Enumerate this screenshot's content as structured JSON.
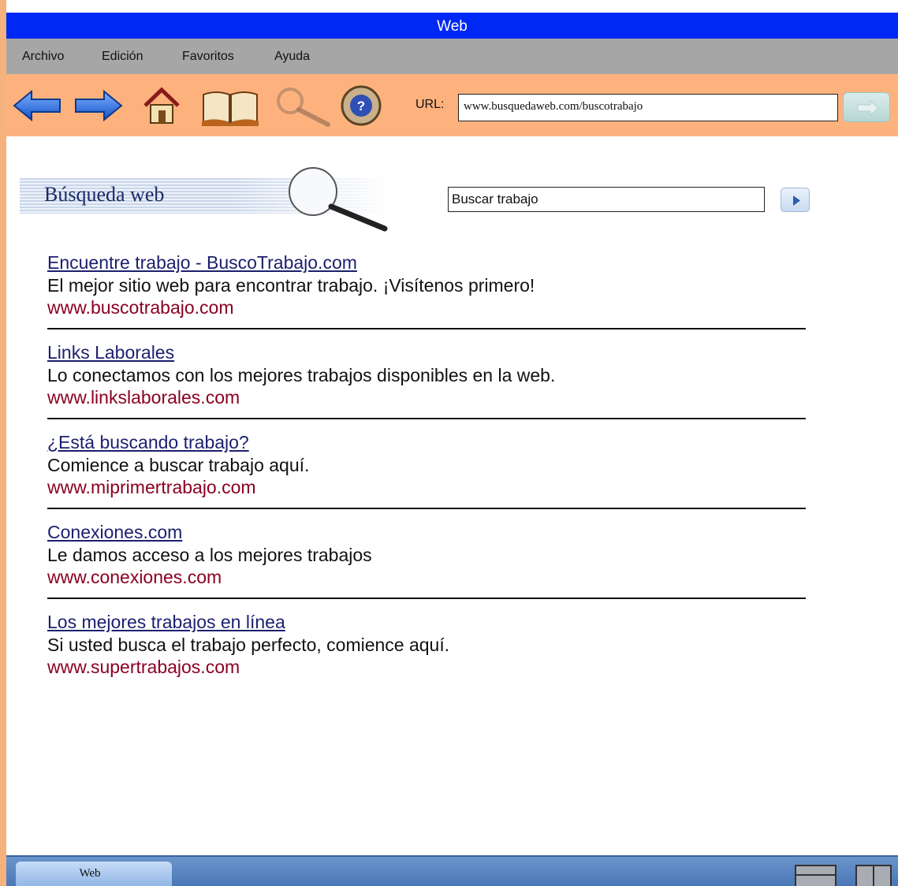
{
  "window": {
    "title": "Web"
  },
  "menu": {
    "items": [
      "Archivo",
      "Edición",
      "Favoritos",
      "Ayuda"
    ]
  },
  "toolbar": {
    "buttons": [
      "back-arrow-icon",
      "forward-arrow-icon",
      "home-icon",
      "book-icon",
      "search-icon",
      "help-icon",
      "go-arrow-icon"
    ],
    "url_label": "URL:",
    "url_value": "www.busquedaweb.com/buscotrabajo"
  },
  "search": {
    "title": "Búsqueda web",
    "query": "Buscar trabajo"
  },
  "results": [
    {
      "title": "Encuentre trabajo - BuscoTrabajo.com",
      "description": "El mejor sitio web para encontrar trabajo. ¡Visítenos primero!",
      "url": "www.buscotrabajo.com"
    },
    {
      "title": "Links Laborales",
      "description": "Lo conectamos con los mejores trabajos disponibles en la web.",
      "url": "www.linkslaborales.com"
    },
    {
      "title": "¿Está buscando trabajo?",
      "description": "Comience a buscar trabajo aquí.",
      "url": "www.miprimertrabajo.com"
    },
    {
      "title": "Conexiones.com",
      "description": "Le damos acceso a los mejores trabajos",
      "url": "www.conexiones.com"
    },
    {
      "title": "Los mejores trabajos en línea",
      "description": "Si usted busca el trabajo perfecto, comience aquí.",
      "url": "www.supertrabajos.com"
    }
  ],
  "taskbar": {
    "active_window": "Web"
  },
  "colors": {
    "titlebar": "#0028f5",
    "toolbar": "#fdb27e",
    "menubar": "#a6a6a6",
    "link": "#1b1f6e",
    "url_text": "#8b0022"
  }
}
